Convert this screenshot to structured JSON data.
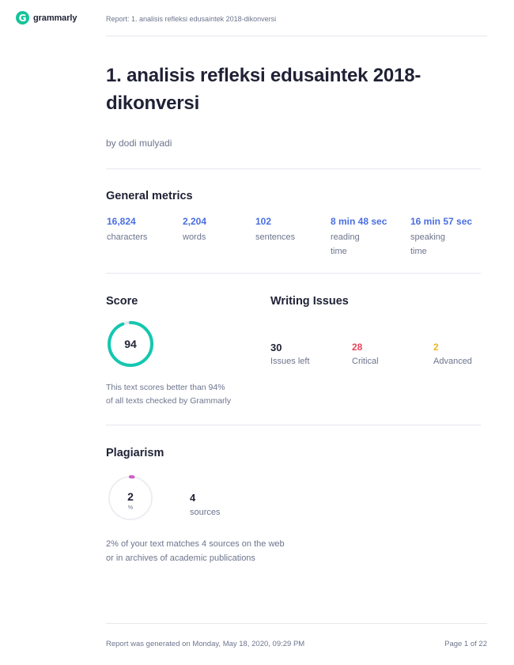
{
  "header": {
    "logo_glyph": "G",
    "logo_text": "grammarly",
    "breadcrumb": "Report: 1. analisis refleksi edusaintek 2018-dikonversi"
  },
  "document": {
    "title": "1. analisis refleksi edusaintek 2018-dikonversi",
    "author": "by dodi mulyadi"
  },
  "general_metrics": {
    "title": "General metrics",
    "items": [
      {
        "value": "16,824",
        "label": "characters"
      },
      {
        "value": "2,204",
        "label": "words"
      },
      {
        "value": "102",
        "label": "sentences"
      },
      {
        "value": "8 min 48 sec",
        "label": "reading time"
      },
      {
        "value": "16 min 57 sec",
        "label": "speaking time"
      }
    ]
  },
  "score": {
    "title": "Score",
    "value": "94",
    "fraction": 0.94,
    "ring_color": "#15c7b0",
    "description_line1": "This text scores better than 94%",
    "description_line2": "of all texts checked by Grammarly"
  },
  "writing_issues": {
    "title": "Writing Issues",
    "items": [
      {
        "value": "30",
        "label": "Issues left",
        "color": "#1f2235"
      },
      {
        "value": "28",
        "label": "Critical",
        "color": "#e8455a"
      },
      {
        "value": "2",
        "label": "Advanced",
        "color": "#f2b51d"
      }
    ]
  },
  "plagiarism": {
    "title": "Plagiarism",
    "percent": "2",
    "percent_sign": "%",
    "fraction": 0.02,
    "ring_color": "#d05ec7",
    "sources_value": "4",
    "sources_label": "sources",
    "description_line1": "2% of your text matches 4 sources on the web",
    "description_line2": "or in archives of academic publications"
  },
  "footer": {
    "generated": "Report was generated on Monday, May 18, 2020, 09:29 PM",
    "page": "Page 1 of 22"
  }
}
